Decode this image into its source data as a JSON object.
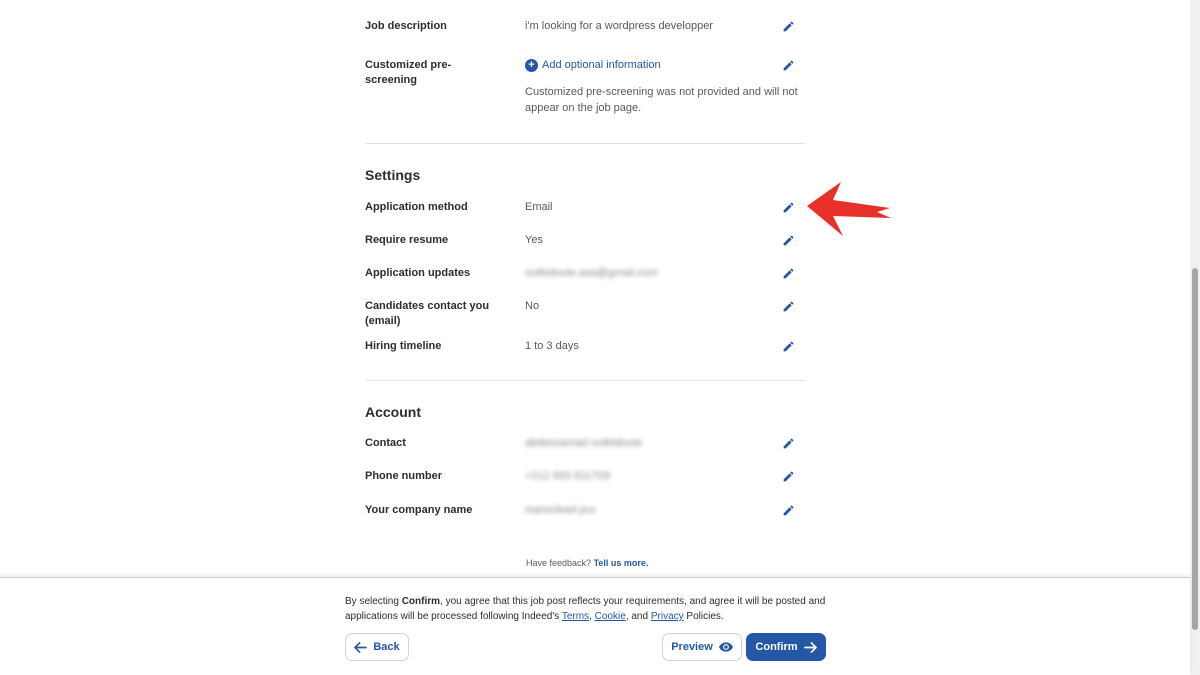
{
  "job": {
    "description_label": "Job description",
    "description_value": "i'm looking for a wordpress developper",
    "prescreen_label": "Customized pre-screening",
    "prescreen_link": "Add optional information",
    "prescreen_note": "Customized pre-screening was not provided and will not appear on the job page."
  },
  "settings": {
    "title": "Settings",
    "rows": [
      {
        "label": "Application method",
        "value": "Email"
      },
      {
        "label": "Require resume",
        "value": "Yes"
      },
      {
        "label": "Application updates",
        "value": "outkidoute.asa@gmail.com"
      },
      {
        "label": "Candidates contact you (email)",
        "value": "No"
      },
      {
        "label": "Hiring timeline",
        "value": "1 to 3 days"
      }
    ]
  },
  "account": {
    "title": "Account",
    "rows": [
      {
        "label": "Contact",
        "value": "abdessamad outkidoute"
      },
      {
        "label": "Phone number",
        "value": "+212 693 811709"
      },
      {
        "label": "Your company name",
        "value": "maroclead pro"
      }
    ]
  },
  "feedback": {
    "text": "Have feedback?",
    "link": "Tell us more."
  },
  "footer": {
    "consent_prefix": "By selecting",
    "consent_bold": "Confirm",
    "consent_middle": ", you agree that this job post reflects your requirements, and agree it will be posted and applications will be processed following Indeed's",
    "terms": "Terms",
    "cookie": "Cookie",
    "and": ", and",
    "privacy": "Privacy",
    "policies": "Policies.",
    "back_label": "Back",
    "preview_label": "Preview",
    "confirm_label": "Confirm"
  },
  "colors": {
    "accent": "#2557a7",
    "annotation_arrow": "#e8302a"
  },
  "icons": {
    "edit": "pencil-icon",
    "add": "plus-circle-icon",
    "back": "arrow-left-icon",
    "preview": "eye-icon",
    "confirm": "arrow-right-icon"
  }
}
